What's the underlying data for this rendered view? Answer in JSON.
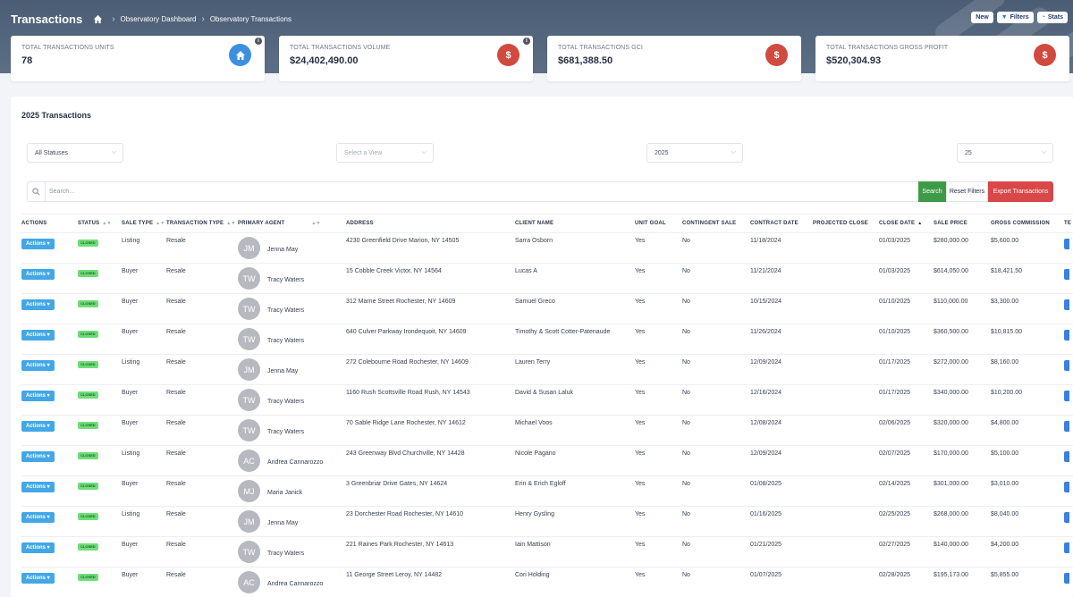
{
  "header": {
    "title": "Transactions",
    "breadcrumbs": [
      "Observatory Dashboard",
      "Observatory Transactions"
    ],
    "actions": [
      {
        "label": "New",
        "icon": ""
      },
      {
        "label": "Filters",
        "icon": "filter-icon"
      },
      {
        "label": "Stats",
        "icon": "chart-icon"
      }
    ]
  },
  "stats": [
    {
      "label": "TOTAL TRANSACTIONS UNITS",
      "value": "78",
      "icon": "home-icon",
      "color": "#3d8fe0",
      "info": true
    },
    {
      "label": "TOTAL TRANSACTIONS VOLUME",
      "value": "$24,402,490.00",
      "icon": "dollar-icon",
      "color": "#d04a40",
      "info": true
    },
    {
      "label": "TOTAL TRANSACTIONS GCI",
      "value": "$681,388.50",
      "icon": "dollar-icon",
      "color": "#d04a40",
      "info": false
    },
    {
      "label": "TOTAL TRANSACTIONS GROSS PROFIT",
      "value": "$520,304.93",
      "icon": "dollar-icon",
      "color": "#d04a40",
      "info": false
    }
  ],
  "panel": {
    "title": "2025 Transactions",
    "filters": {
      "status": "All Statuses",
      "view_placeholder": "Select a View",
      "year": "2025",
      "page_size": "25"
    },
    "search_placeholder": "Search...",
    "search_button": "Search",
    "reset_button": "Reset Filters",
    "export_button": "Export Transactions"
  },
  "table": {
    "columns": [
      "ACTIONS",
      "STATUS",
      "SALE TYPE",
      "TRANSACTION TYPE",
      "PRIMARY AGENT",
      "ADDRESS",
      "CLIENT NAME",
      "UNIT GOAL",
      "CONTINGENT SALE",
      "CONTRACT DATE",
      "PROJECTED CLOSE",
      "CLOSE DATE",
      "SALE PRICE",
      "GROSS COMMISSION",
      "TE"
    ],
    "action_label": "Actions",
    "rows": [
      {
        "status": "CLOSED",
        "sale_type": "Listing",
        "txn_type": "Resale",
        "initials": "JM",
        "agent": "Jenna May",
        "address": "4230 Greenfield Drive Marion, NY 14505",
        "client": "Sarra Osborn",
        "unit_goal": "Yes",
        "contingent": "No",
        "contract": "11/18/2024",
        "projected": "",
        "close": "01/03/2025",
        "price": "$280,000.00",
        "commission": "$5,600.00"
      },
      {
        "status": "CLOSED",
        "sale_type": "Buyer",
        "txn_type": "Resale",
        "initials": "TW",
        "agent": "Tracy Waters",
        "address": "15 Cobble Creek Victor, NY 14564",
        "client": "Lucas A",
        "unit_goal": "Yes",
        "contingent": "No",
        "contract": "11/21/2024",
        "projected": "",
        "close": "01/03/2025",
        "price": "$614,050.00",
        "commission": "$18,421.50"
      },
      {
        "status": "CLOSED",
        "sale_type": "Buyer",
        "txn_type": "Resale",
        "initials": "TW",
        "agent": "Tracy Waters",
        "address": "312 Marne Street Rochester, NY 14609",
        "client": "Samuel Greco",
        "unit_goal": "Yes",
        "contingent": "No",
        "contract": "10/15/2024",
        "projected": "",
        "close": "01/10/2025",
        "price": "$110,000.00",
        "commission": "$3,300.00"
      },
      {
        "status": "CLOSED",
        "sale_type": "Buyer",
        "txn_type": "Resale",
        "initials": "TW",
        "agent": "Tracy Waters",
        "address": "640 Culver Parkway Irondequoit, NY 14609",
        "client": "Timothy & Scott Cotter-Patenaude",
        "unit_goal": "Yes",
        "contingent": "No",
        "contract": "11/26/2024",
        "projected": "",
        "close": "01/10/2025",
        "price": "$360,500.00",
        "commission": "$10,815.00"
      },
      {
        "status": "CLOSED",
        "sale_type": "Listing",
        "txn_type": "Resale",
        "initials": "JM",
        "agent": "Jenna May",
        "address": "272 Colebourne Road Rochester, NY 14609",
        "client": "Lauren Terry",
        "unit_goal": "Yes",
        "contingent": "No",
        "contract": "12/09/2024",
        "projected": "",
        "close": "01/17/2025",
        "price": "$272,000.00",
        "commission": "$8,160.00"
      },
      {
        "status": "CLOSED",
        "sale_type": "Buyer",
        "txn_type": "Resale",
        "initials": "TW",
        "agent": "Tracy Waters",
        "address": "1160 Rush Scottsville Road Rush, NY 14543",
        "client": "David & Susan Laluk",
        "unit_goal": "Yes",
        "contingent": "No",
        "contract": "12/16/2024",
        "projected": "",
        "close": "01/17/2025",
        "price": "$340,000.00",
        "commission": "$10,200.00"
      },
      {
        "status": "CLOSED",
        "sale_type": "Buyer",
        "txn_type": "Resale",
        "initials": "TW",
        "agent": "Tracy Waters",
        "address": "70 Sable Ridge Lane Rochester, NY 14612",
        "client": "Michael Voos",
        "unit_goal": "Yes",
        "contingent": "No",
        "contract": "12/08/2024",
        "projected": "",
        "close": "02/06/2025",
        "price": "$320,000.00",
        "commission": "$4,800.00"
      },
      {
        "status": "CLOSED",
        "sale_type": "Listing",
        "txn_type": "Resale",
        "initials": "AC",
        "agent": "Andrea Cannarozzo",
        "address": "243 Greenway Blvd Churchville, NY 14428",
        "client": "Nicole Pagano",
        "unit_goal": "Yes",
        "contingent": "No",
        "contract": "12/09/2024",
        "projected": "",
        "close": "02/07/2025",
        "price": "$170,000.00",
        "commission": "$5,100.00"
      },
      {
        "status": "CLOSED",
        "sale_type": "Buyer",
        "txn_type": "Resale",
        "initials": "MJ",
        "agent": "Maria Janick",
        "address": "3 Greenbriar Drive Gates, NY 14624",
        "client": "Erin & Erich Egloff",
        "unit_goal": "Yes",
        "contingent": "No",
        "contract": "01/08/2025",
        "projected": "",
        "close": "02/14/2025",
        "price": "$301,000.00",
        "commission": "$3,010.00"
      },
      {
        "status": "CLOSED",
        "sale_type": "Listing",
        "txn_type": "Resale",
        "initials": "JM",
        "agent": "Jenna May",
        "address": "23 Dorchester Road Rochester, NY 14610",
        "client": "Henry Gysling",
        "unit_goal": "Yes",
        "contingent": "No",
        "contract": "01/16/2025",
        "projected": "",
        "close": "02/25/2025",
        "price": "$268,000.00",
        "commission": "$8,040.00"
      },
      {
        "status": "CLOSED",
        "sale_type": "Buyer",
        "txn_type": "Resale",
        "initials": "TW",
        "agent": "Tracy Waters",
        "address": "221 Raines Park Rochester, NY 14613",
        "client": "Iain Mattison",
        "unit_goal": "Yes",
        "contingent": "No",
        "contract": "01/21/2025",
        "projected": "",
        "close": "02/27/2025",
        "price": "$140,000.00",
        "commission": "$4,200.00"
      },
      {
        "status": "CLOSED",
        "sale_type": "Buyer",
        "txn_type": "Resale",
        "initials": "AC",
        "agent": "Andrea Cannarozzo",
        "address": "11 George Street Leroy, NY 14482",
        "client": "Cori Holding",
        "unit_goal": "Yes",
        "contingent": "No",
        "contract": "01/07/2025",
        "projected": "",
        "close": "02/28/2025",
        "price": "$195,173.00",
        "commission": "$5,855.00"
      }
    ]
  }
}
